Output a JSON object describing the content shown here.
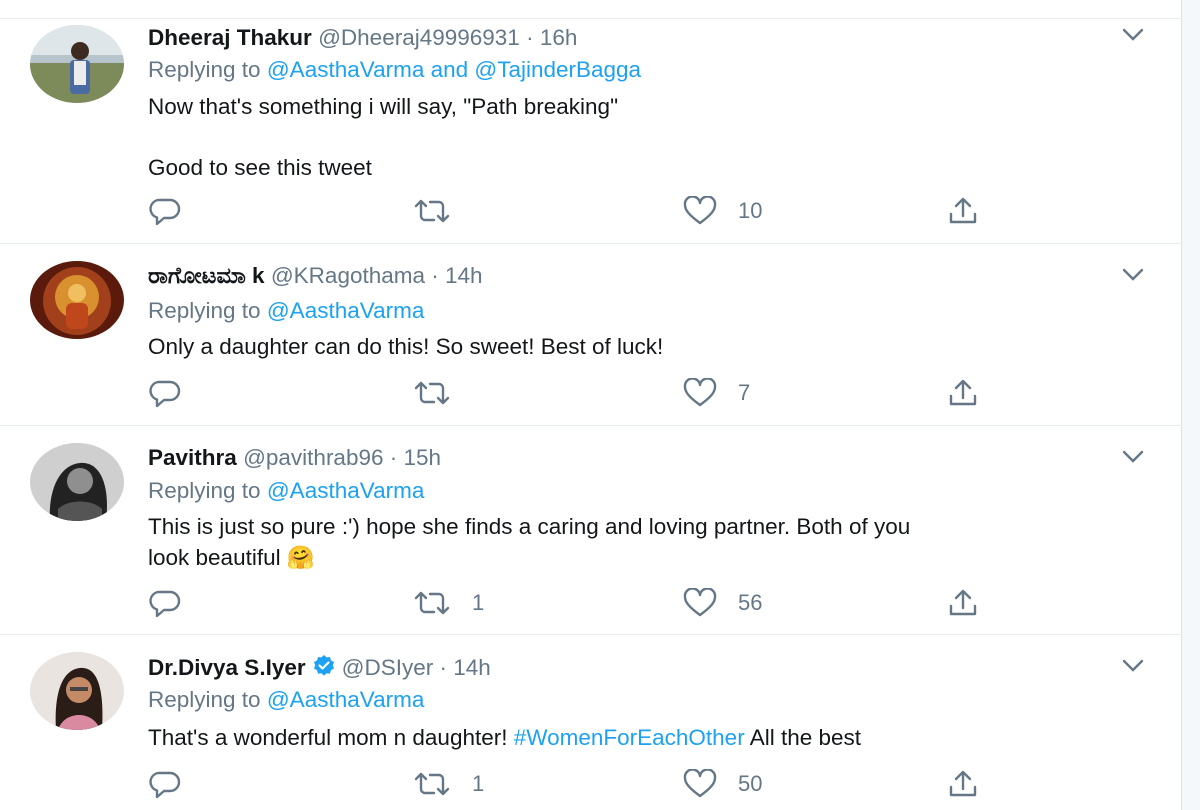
{
  "tweets": [
    {
      "name": "Dheeraj Thakur",
      "handle": "@Dheeraj49996931",
      "time": "16h",
      "replying_prefix": "Replying to",
      "replying_to": "@AasthaVarma and @TajinderBagga",
      "text_line1": "Now that's something i will say, \"Path breaking\"",
      "text_line2": "Good to see this tweet",
      "likes": "10",
      "retweets": ""
    },
    {
      "name": "ರಾಗೋಟಮಾ k",
      "handle": "@KRagothama",
      "time": "14h",
      "replying_prefix": "Replying to",
      "replying_to": "@AasthaVarma",
      "text_line1": "Only a daughter can do this! So sweet! Best of luck!",
      "likes": "7",
      "retweets": ""
    },
    {
      "name": "Pavithra",
      "handle": "@pavithrab96",
      "time": "15h",
      "replying_prefix": "Replying to",
      "replying_to": "@AasthaVarma",
      "text_line1": "This is just so pure :') hope she finds a caring and loving partner. Both of you",
      "text_line2": "look beautiful",
      "emoji": "🤗",
      "likes": "56",
      "retweets": "1"
    },
    {
      "name": "Dr.Divya S.Iyer",
      "verified": true,
      "handle": "@DSIyer",
      "time": "14h",
      "replying_prefix": "Replying to",
      "replying_to": "@AasthaVarma",
      "text_before": "That's a wonderful mom n daughter! ",
      "hashtag": "#WomenForEachOther",
      "text_after": " All the best",
      "likes": "50",
      "retweets": "1"
    }
  ],
  "separator": " · ",
  "icons": [
    "reply-icon",
    "retweet-icon",
    "like-icon",
    "share-icon",
    "chevron-down-icon",
    "verified-badge-icon"
  ],
  "colors": {
    "link": "#1da1f2",
    "muted": "#657786",
    "text": "#14171a"
  }
}
